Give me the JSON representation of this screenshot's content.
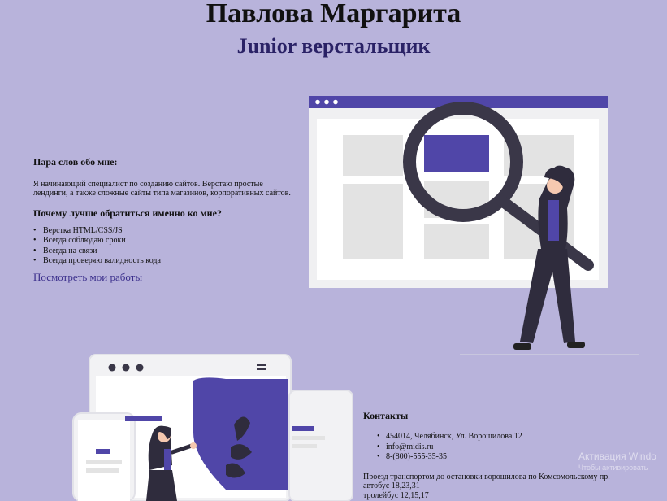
{
  "header": {
    "name": "Павлова Маргарита",
    "role": "Junior верстальщик"
  },
  "about": {
    "title": "Пара слов обо мне:",
    "text": "Я начинающий специалист по созданию сайтов. Верстаю простые лендинги, а также сложные сайты типа магазинов, корпоративных сайтов.",
    "why_title": "Почему лучше обратиться именно ко мне?",
    "bullets": [
      "Верстка HTML/CSS/JS",
      "Всегда соблюдаю сроки",
      "Всегда на связи",
      "Всегда проверяю валидность кода"
    ],
    "link": "Посмотреть мои работы"
  },
  "contacts": {
    "title": "Контакты",
    "items": [
      "454014, Челябинск, Ул. Ворошилова 12",
      "info@midis.ru",
      "8-(800)-555-35-35"
    ],
    "transport_intro": "Проезд транспортом до остановки ворошилова по Комсомольскому пр.",
    "bus": "автобус 18,23,31",
    "trolley": "тролейбус 12,15,17"
  },
  "watermark": {
    "line1": "Активация Windo",
    "line2": "Чтобы активировать"
  },
  "colors": {
    "background": "#b8b3db",
    "accent": "#5046a8",
    "dark": "#2f2c3d"
  },
  "illustrations": {
    "search_illustration": "woman-with-magnifier-icon",
    "devices_illustration": "woman-with-devices-icon"
  }
}
